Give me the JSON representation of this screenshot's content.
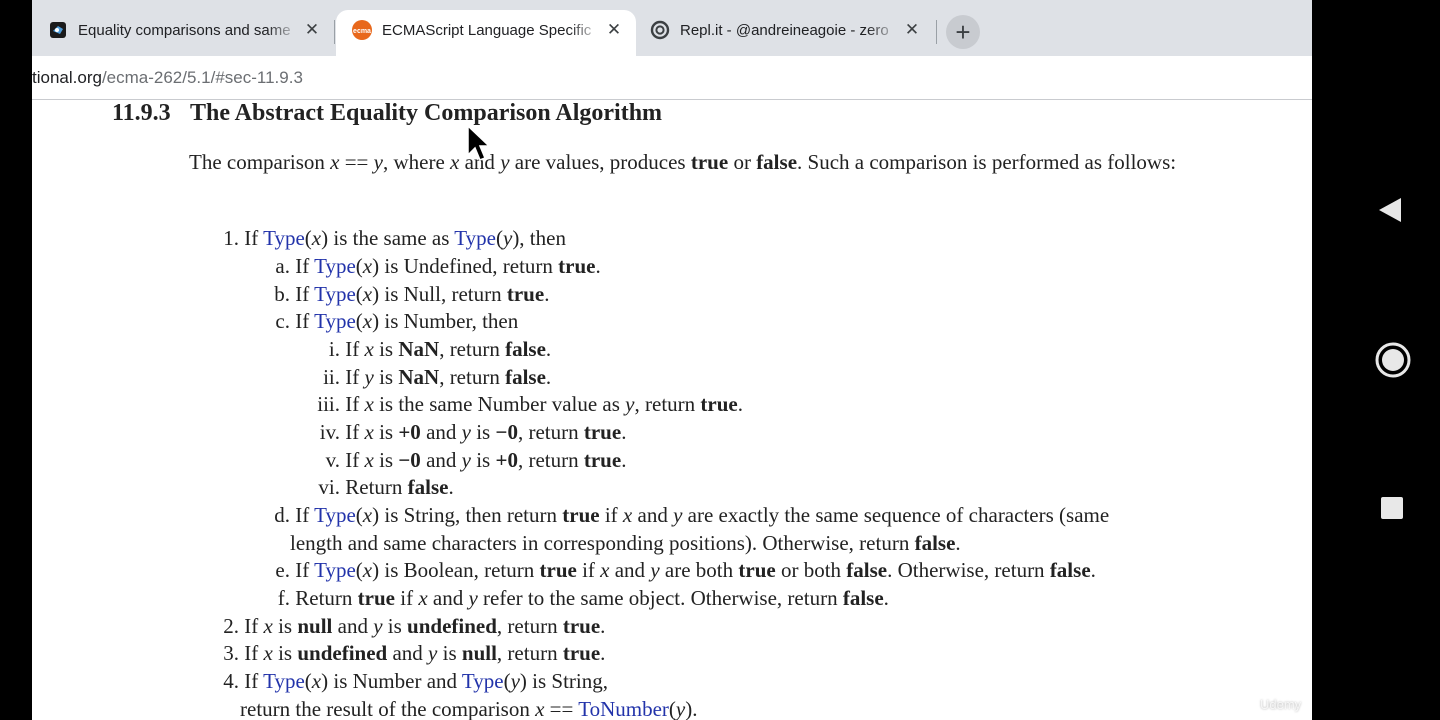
{
  "browser": {
    "tabs": [
      {
        "title": "Equality comparisons and same",
        "favicon": "mdn-icon",
        "active": false
      },
      {
        "title": "ECMAScript Language Specific",
        "favicon": "ecma-icon",
        "favicon_text": "ecma",
        "active": true
      },
      {
        "title": "Repl.it - @andreineagoie - zero",
        "favicon": "replit-icon",
        "active": false
      }
    ],
    "new_tab": "+",
    "close_glyph": "✕",
    "url_host": "tional.org",
    "url_path": "/ecma-262/5.1/#sec-11.9.3"
  },
  "doc": {
    "section_number": "11.9.3",
    "section_title": "The Abstract Equality Comparison Algorithm"
  },
  "watermark": "Udemy",
  "colors": {
    "link": "#2233aa",
    "tabstrip": "#dee1e6",
    "ecma_brand": "#e8681c"
  },
  "nav_icons": [
    "back-triangle-icon",
    "home-circle-icon",
    "recents-square-icon"
  ]
}
